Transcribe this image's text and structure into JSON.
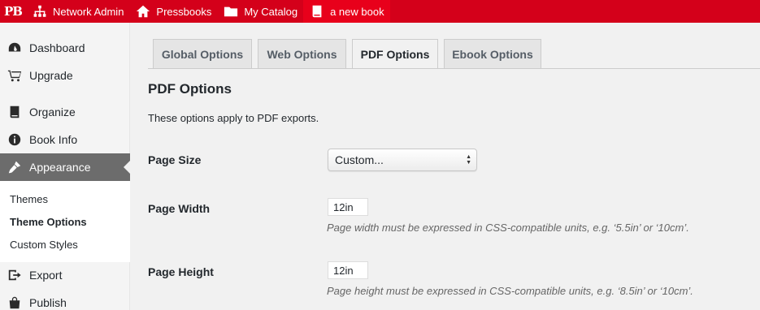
{
  "adminbar": {
    "logo": "PB",
    "items": [
      {
        "label": "Network Admin",
        "icon": "network-icon"
      },
      {
        "label": "Pressbooks",
        "icon": "home-icon"
      },
      {
        "label": "My Catalog",
        "icon": "folder-icon"
      },
      {
        "label": "a new book",
        "icon": "book-icon"
      }
    ],
    "color": "#d4001a"
  },
  "sidebar": {
    "items": [
      {
        "label": "Dashboard",
        "icon": "dashboard-icon"
      },
      {
        "label": "Upgrade",
        "icon": "cart-icon"
      },
      {
        "label": "Organize",
        "icon": "book-icon"
      },
      {
        "label": "Book Info",
        "icon": "info-icon"
      },
      {
        "label": "Appearance",
        "icon": "paintbrush-icon"
      },
      {
        "label": "Export",
        "icon": "export-icon"
      },
      {
        "label": "Publish",
        "icon": "bag-icon"
      }
    ],
    "submenu": [
      "Themes",
      "Theme Options",
      "Custom Styles"
    ],
    "current": "Appearance",
    "current_sub": "Theme Options"
  },
  "tabs": [
    {
      "label": "Global Options"
    },
    {
      "label": "Web Options"
    },
    {
      "label": "PDF Options"
    },
    {
      "label": "Ebook Options"
    }
  ],
  "active_tab": "PDF Options",
  "content": {
    "heading": "PDF Options",
    "description": "These options apply to PDF exports.",
    "page_size": {
      "label": "Page Size",
      "value": "Custom..."
    },
    "page_width": {
      "label": "Page Width",
      "value": "12in",
      "hint": "Page width must be expressed in CSS-compatible units, e.g. ‘5.5in’ or ‘10cm’."
    },
    "page_height": {
      "label": "Page Height",
      "value": "12in",
      "hint": "Page height must be expressed in CSS-compatible units, e.g. ‘8.5in’ or ‘10cm’."
    }
  }
}
